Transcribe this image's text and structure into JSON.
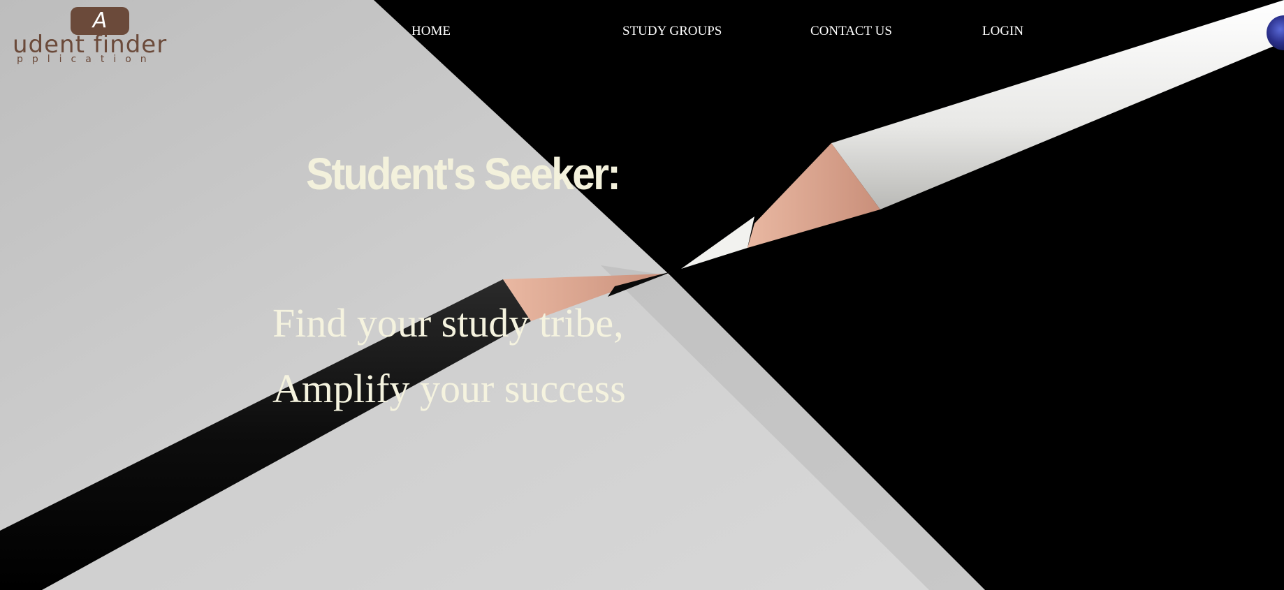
{
  "logo": {
    "badge_letter": "A",
    "name": "udent finder",
    "subtitle": "pplication"
  },
  "nav": {
    "items": [
      {
        "label": "HOME"
      },
      {
        "label": "STUDY GROUPS"
      },
      {
        "label": "CONTACT US"
      },
      {
        "label": "LOGIN"
      }
    ]
  },
  "hero": {
    "headline": "Student's Seeker:",
    "tagline_line1": "Find your study tribe,",
    "tagline_line2": "Amplify your success"
  },
  "colors": {
    "brand_brown": "#6b4a3a",
    "hero_text": "#f5f3df",
    "nav_text": "#ffffff"
  }
}
